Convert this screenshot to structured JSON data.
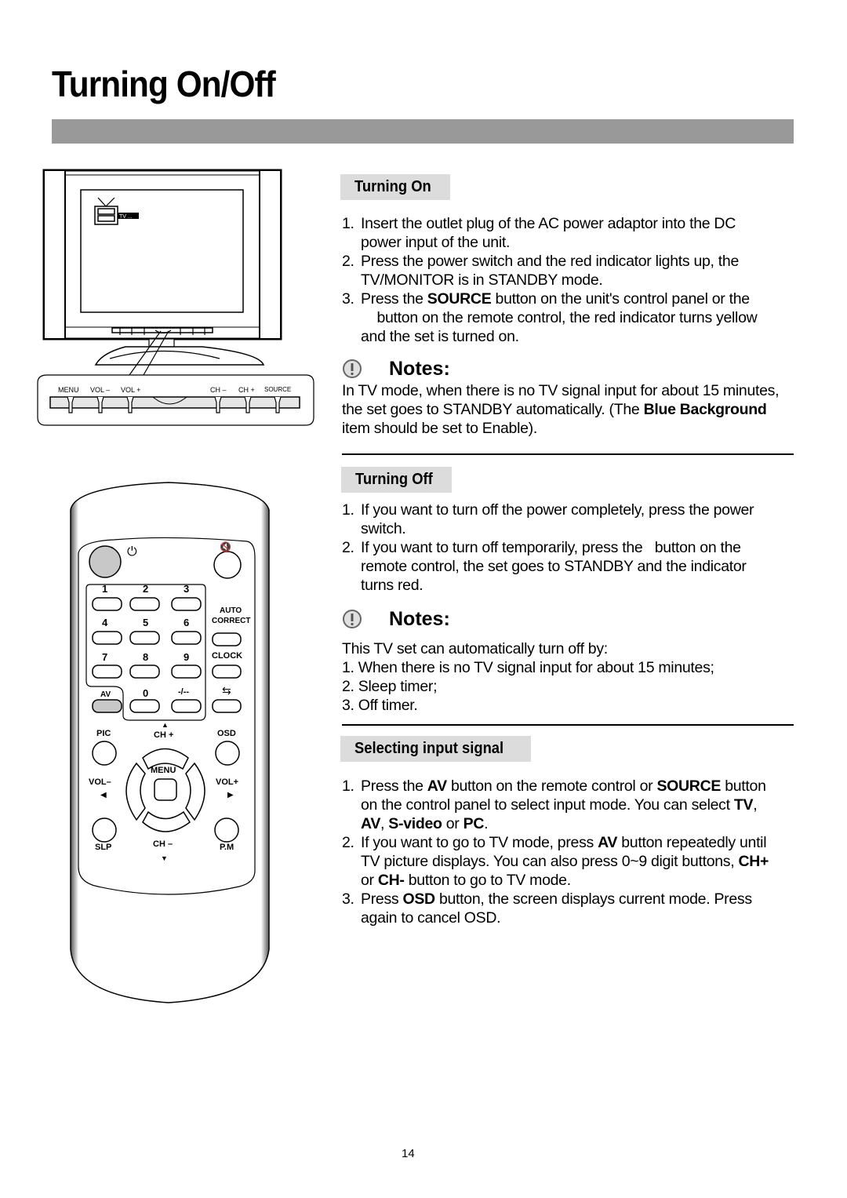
{
  "page": {
    "title": "Turning On/Off",
    "page_number": "14"
  },
  "tv_diagram": {
    "osd_text": "TV  ...",
    "panel_labels": [
      "MENU",
      "VOL –",
      "VOL +",
      "CH –",
      "CH +",
      "SOURCE"
    ]
  },
  "remote": {
    "power_symbol": "⏻",
    "mute_symbol": "🔇",
    "digits": [
      "1",
      "2",
      "3",
      "4",
      "5",
      "6",
      "7",
      "8",
      "9"
    ],
    "auto_correct": [
      "AUTO",
      "CORRECT"
    ],
    "clock": "CLOCK",
    "av": "AV",
    "zero": "0",
    "dash": "-/--",
    "recall_symbol": "⇆",
    "pic": "PIC",
    "ch_plus": "CH +",
    "osd": "OSD",
    "menu": "MENU",
    "vol_minus": "VOL–",
    "vol_plus": "VOL+",
    "slp": "SLP",
    "ch_minus": "CH –",
    "pm": "P.M",
    "up_arrow": "▲",
    "down_arrow": "▼",
    "left_arrow": "◀",
    "right_arrow": "▶"
  },
  "turning_on": {
    "heading": "Turning On",
    "steps": [
      {
        "num": "1.",
        "parts": [
          {
            "t": "Insert the outlet plug of the AC power adaptor into the DC power input of the unit."
          }
        ]
      },
      {
        "num": "2.",
        "parts": [
          {
            "t": "Press the power switch and the red indicator lights up, the TV/MONITOR is in STANDBY mode."
          }
        ]
      },
      {
        "num": "3.",
        "parts": [
          {
            "t": "Press the "
          },
          {
            "t": "SOURCE",
            "b": true
          },
          {
            "t": " button on the unit's control panel or the     button on the remote control, the red indicator turns yellow and the set is turned on."
          }
        ]
      }
    ]
  },
  "notes_1": {
    "heading": "Notes:",
    "parts": [
      {
        "t": "In TV mode, when there is no TV signal input for about 15 minutes, the set goes to STANDBY automatically. (The "
      },
      {
        "t": "Blue Background",
        "b": true
      },
      {
        "t": " item should be set to Enable)."
      }
    ]
  },
  "turning_off": {
    "heading": "Turning Off",
    "steps": [
      {
        "num": "1.",
        "parts": [
          {
            "t": "If you want to turn off the power completely, press the power switch."
          }
        ]
      },
      {
        "num": "2.",
        "parts": [
          {
            "t": "If you want to turn off temporarily, press the   button on the remote control, the set goes to STANDBY and the indicator turns red."
          }
        ]
      }
    ]
  },
  "notes_2": {
    "heading": "Notes:",
    "intro": "This TV set can automatically turn off by:",
    "items": [
      "1. When there is no TV signal input for about 15 minutes;",
      "2. Sleep timer;",
      "3. Off timer."
    ]
  },
  "selecting_input": {
    "heading": "Selecting input signal",
    "steps": [
      {
        "num": "1.",
        "parts": [
          {
            "t": "Press the "
          },
          {
            "t": "AV",
            "b": true
          },
          {
            "t": " button on the remote control or "
          },
          {
            "t": "SOURCE",
            "b": true
          },
          {
            "t": " button on the control panel to select input mode. You can select "
          },
          {
            "t": "TV",
            "b": true
          },
          {
            "t": ", "
          },
          {
            "t": "AV",
            "b": true
          },
          {
            "t": ", "
          },
          {
            "t": "S-video",
            "b": true
          },
          {
            "t": " or "
          },
          {
            "t": "PC",
            "b": true
          },
          {
            "t": "."
          }
        ]
      },
      {
        "num": "2.",
        "parts": [
          {
            "t": "If you want to go to TV mode, press "
          },
          {
            "t": "AV",
            "b": true
          },
          {
            "t": " button repeatedly until TV picture displays. You can also press 0~9 digit buttons, "
          },
          {
            "t": "CH+",
            "b": true
          },
          {
            "t": " or "
          },
          {
            "t": "CH-",
            "b": true
          },
          {
            "t": " button to go to TV mode."
          }
        ]
      },
      {
        "num": "3.",
        "parts": [
          {
            "t": "Press "
          },
          {
            "t": "OSD",
            "b": true
          },
          {
            "t": " button, the screen displays current mode. Press again to cancel OSD."
          }
        ]
      }
    ]
  }
}
